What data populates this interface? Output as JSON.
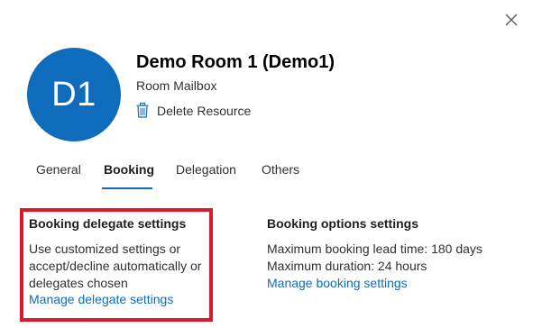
{
  "panel": {
    "close_icon": "close-icon"
  },
  "header": {
    "avatar_initials": "D1",
    "avatar_color": "#0f6cbd",
    "title": "Demo Room 1 (Demo1)",
    "subtitle": "Room Mailbox",
    "delete_label": "Delete Resource",
    "delete_icon": "trash-icon"
  },
  "tabs": [
    {
      "label": "General",
      "active": false
    },
    {
      "label": "Booking",
      "active": true
    },
    {
      "label": "Delegation",
      "active": false
    },
    {
      "label": "Others",
      "active": false
    }
  ],
  "booking_delegate": {
    "heading": "Booking delegate settings",
    "lines": [
      "Use customized settings or",
      "accept/decline automatically or",
      "delegates chosen"
    ],
    "link": "Manage delegate settings",
    "highlight_color": "#d91a2a"
  },
  "booking_options": {
    "heading": "Booking options settings",
    "lines": [
      "Maximum booking lead time: 180 days",
      "Maximum duration: 24 hours"
    ],
    "link": "Manage booking settings"
  },
  "colors": {
    "accent": "#0f6cbd",
    "text": "#323130",
    "highlight": "#d91a2a"
  }
}
